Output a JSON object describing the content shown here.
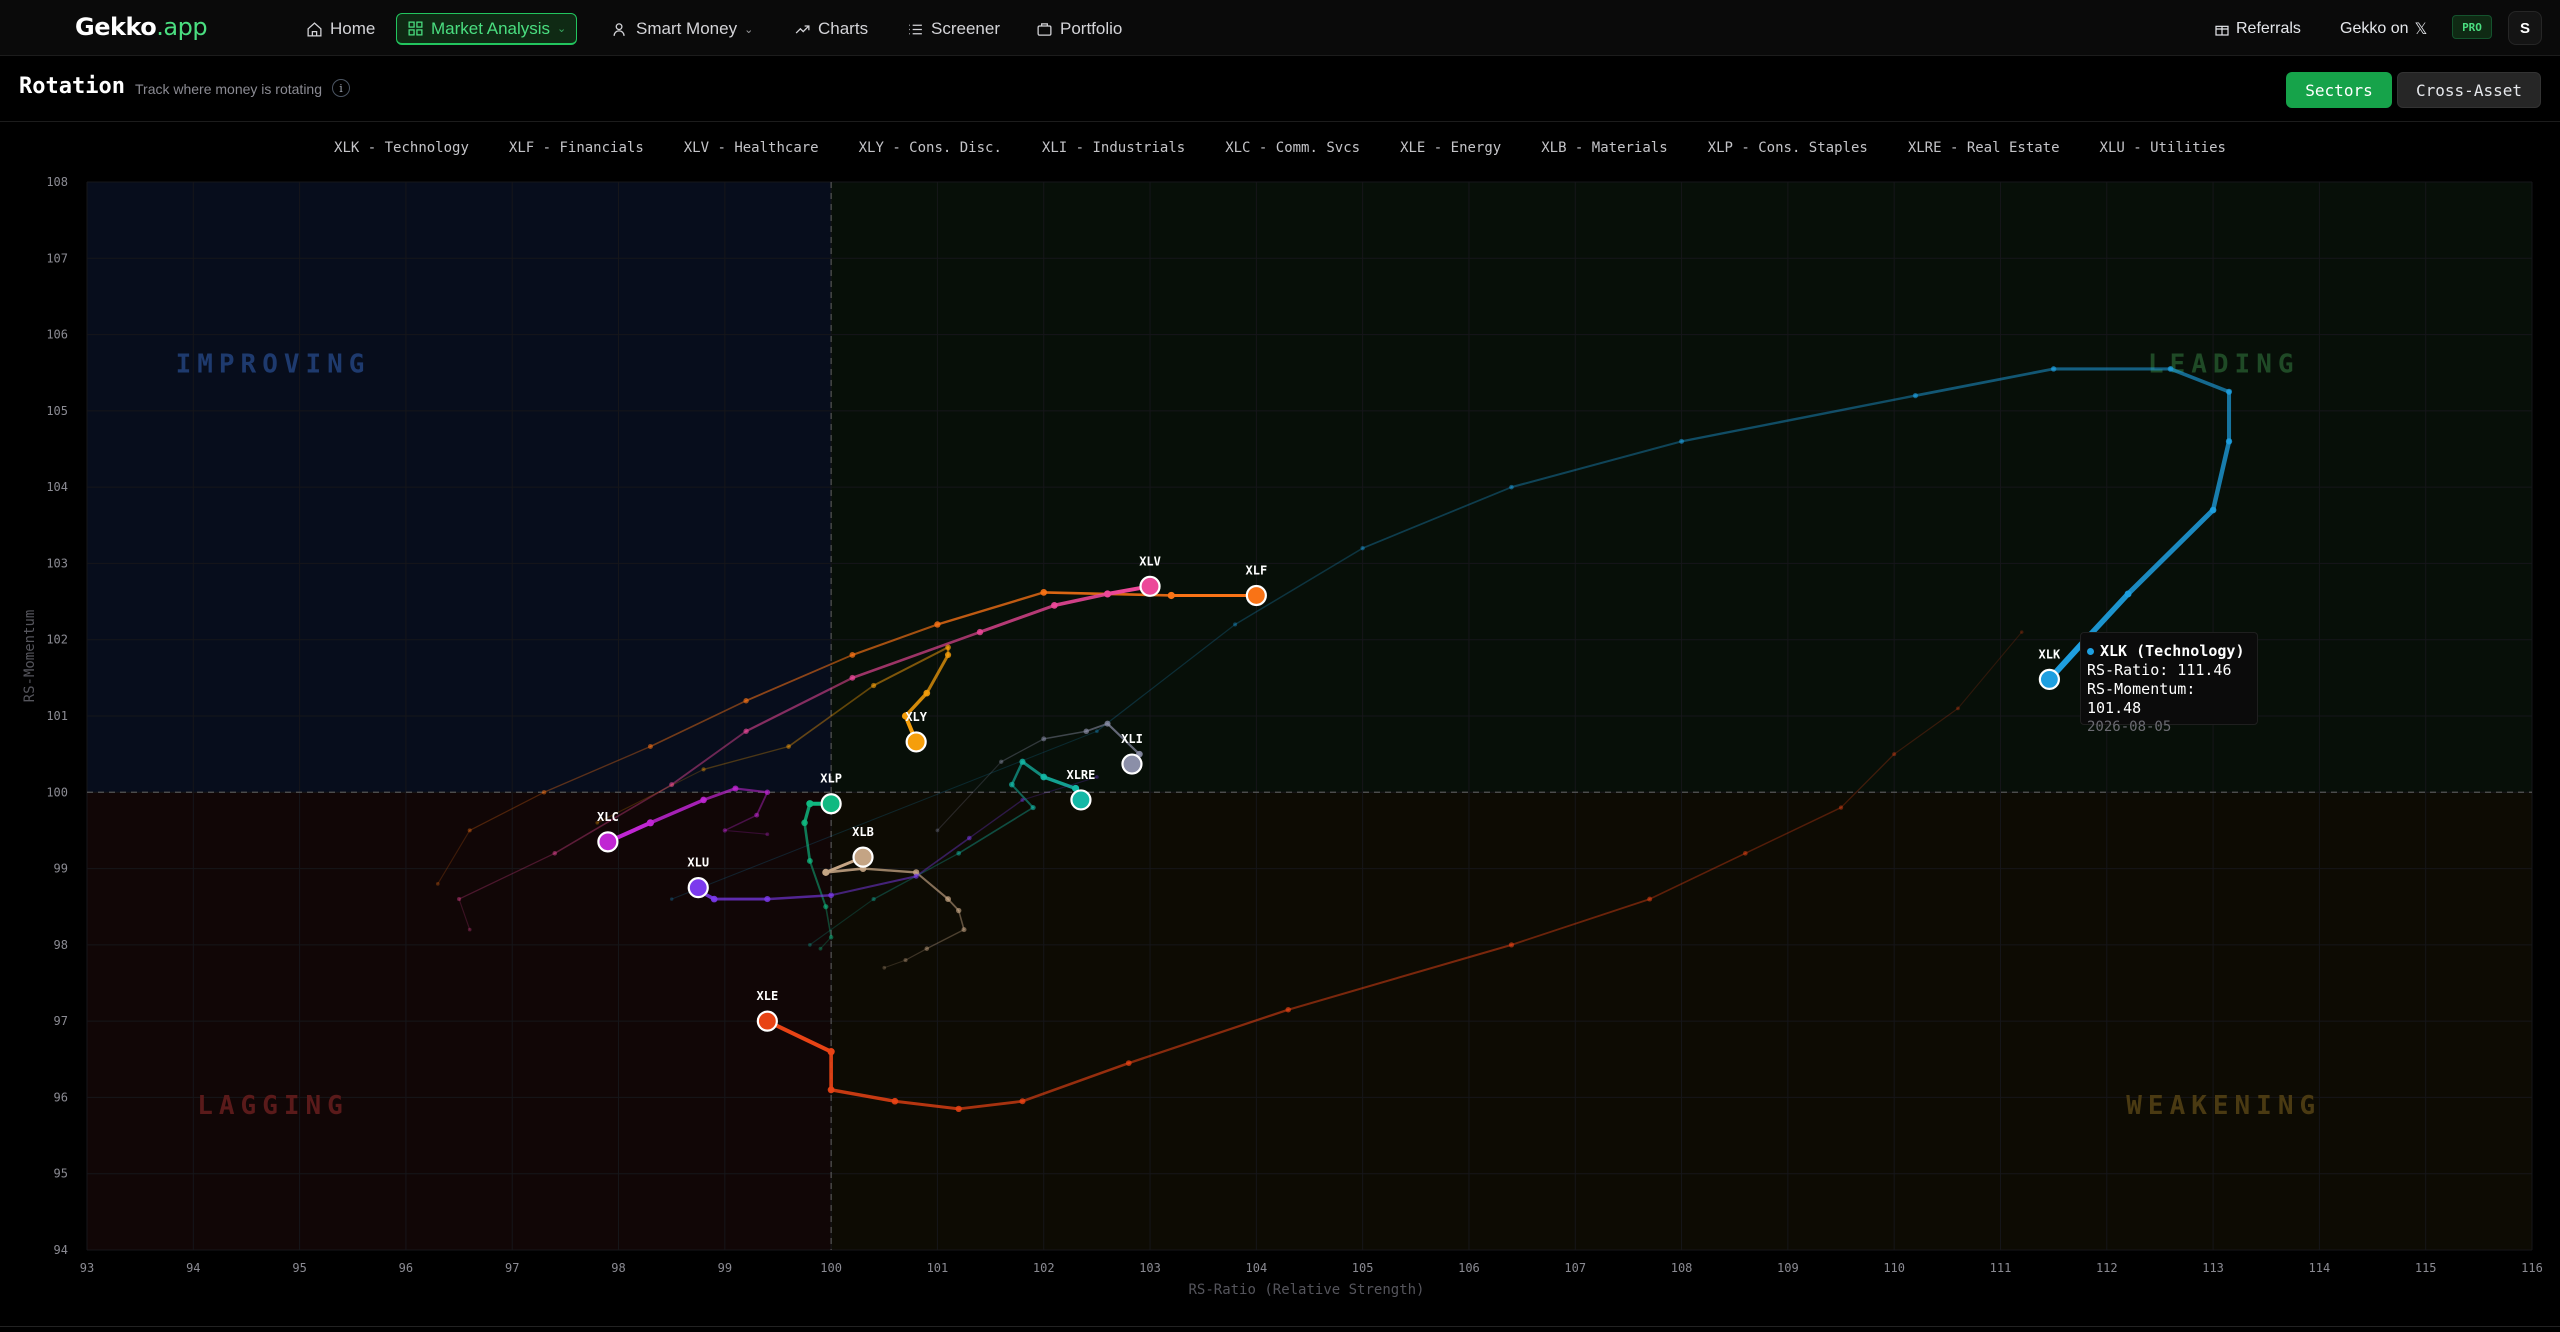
{
  "app": {
    "logo_main": "Gekko",
    "logo_suffix": ".app"
  },
  "nav": {
    "items": [
      {
        "label": "Home",
        "icon": "home-icon"
      },
      {
        "label": "Market Analysis",
        "icon": "grid-icon",
        "active": true,
        "dropdown": true
      },
      {
        "label": "Smart Money",
        "icon": "user-icon",
        "dropdown": true
      },
      {
        "label": "Charts",
        "icon": "trend-icon"
      },
      {
        "label": "Screener",
        "icon": "list-icon"
      },
      {
        "label": "Portfolio",
        "icon": "briefcase-icon"
      }
    ],
    "referrals": "Referrals",
    "gekko_on": "Gekko on",
    "x_icon": "𝕏",
    "pro": "PRO",
    "avatar": "S"
  },
  "header": {
    "title": "Rotation",
    "subtitle": "Track where money is rotating",
    "info": "i",
    "sectors_btn": "Sectors",
    "cross_asset_btn": "Cross-Asset"
  },
  "legend": [
    "XLK - Technology",
    "XLF - Financials",
    "XLV - Healthcare",
    "XLY - Cons. Disc.",
    "XLI - Industrials",
    "XLC - Comm. Svcs",
    "XLE - Energy",
    "XLB - Materials",
    "XLP - Cons. Staples",
    "XLRE - Real Estate",
    "XLU - Utilities"
  ],
  "tooltip": {
    "title": "XLK (Technology)",
    "ratio": "RS-Ratio: 111.46",
    "momentum": "RS-Momentum: 101.48",
    "date": "2026-08-05",
    "color": "#1e9fe0"
  },
  "chart_data": {
    "type": "scatter",
    "xlabel": "RS-Ratio (Relative Strength)",
    "ylabel": "RS-Momentum",
    "xlim": [
      93,
      116
    ],
    "ylim": [
      94,
      108
    ],
    "xticks": [
      93,
      94,
      95,
      96,
      97,
      98,
      99,
      100,
      101,
      102,
      103,
      104,
      105,
      106,
      107,
      108,
      109,
      110,
      111,
      112,
      113,
      114,
      115,
      116
    ],
    "yticks": [
      94,
      95,
      96,
      97,
      98,
      99,
      100,
      101,
      102,
      103,
      104,
      105,
      106,
      107,
      108
    ],
    "quadrants": {
      "improving": {
        "label": "IMPROVING",
        "color": "#1e3a6e"
      },
      "leading": {
        "label": "LEADING",
        "color": "#1f4a26"
      },
      "lagging": {
        "label": "LAGGING",
        "color": "#5a1a1a"
      },
      "weakening": {
        "label": "WEAKENING",
        "color": "#4a3a12"
      }
    },
    "series": [
      {
        "name": "XLK",
        "color": "#1e9fe0",
        "bold": 6,
        "points": [
          [
            98.5,
            98.6
          ],
          [
            102.5,
            100.8
          ],
          [
            103.8,
            102.2
          ],
          [
            105,
            103.2
          ],
          [
            106.4,
            104.0
          ],
          [
            108,
            104.6
          ],
          [
            110.2,
            105.2
          ],
          [
            111.5,
            105.55
          ],
          [
            112.6,
            105.55
          ],
          [
            113.15,
            105.25
          ],
          [
            113.15,
            104.6
          ],
          [
            113.0,
            103.7
          ],
          [
            112.2,
            102.6
          ],
          [
            111.8,
            102.0
          ],
          [
            111.46,
            101.48
          ]
        ]
      },
      {
        "name": "XLF",
        "color": "#f97316",
        "bold": 3,
        "points": [
          [
            96.3,
            98.8
          ],
          [
            96.6,
            99.5
          ],
          [
            97.3,
            100.0
          ],
          [
            98.3,
            100.6
          ],
          [
            99.2,
            101.2
          ],
          [
            100.2,
            101.8
          ],
          [
            101.0,
            102.2
          ],
          [
            102.0,
            102.62
          ],
          [
            103.2,
            102.58
          ],
          [
            104.0,
            102.58
          ]
        ]
      },
      {
        "name": "XLV",
        "color": "#ec4899",
        "bold": 4,
        "points": [
          [
            96.6,
            98.2
          ],
          [
            96.5,
            98.6
          ],
          [
            97.4,
            99.2
          ],
          [
            98.5,
            100.1
          ],
          [
            99.2,
            100.8
          ],
          [
            100.2,
            101.5
          ],
          [
            101.4,
            102.1
          ],
          [
            102.1,
            102.45
          ],
          [
            102.6,
            102.6
          ],
          [
            103.0,
            102.7
          ]
        ]
      },
      {
        "name": "XLY",
        "color": "#f59e0b",
        "bold": 4,
        "points": [
          [
            97.8,
            99.6
          ],
          [
            98.8,
            100.3
          ],
          [
            99.6,
            100.6
          ],
          [
            100.4,
            101.4
          ],
          [
            101.1,
            101.9
          ],
          [
            101.1,
            101.8
          ],
          [
            100.9,
            101.3
          ],
          [
            100.7,
            101.0
          ],
          [
            100.8,
            100.66
          ]
        ]
      },
      {
        "name": "XLI",
        "color": "#8b8fa8",
        "bold": 3,
        "points": [
          [
            101.0,
            99.5
          ],
          [
            101.6,
            100.4
          ],
          [
            102.0,
            100.7
          ],
          [
            102.4,
            100.8
          ],
          [
            102.6,
            100.9
          ],
          [
            102.9,
            100.5
          ],
          [
            102.8,
            100.3
          ],
          [
            102.83,
            100.37
          ]
        ]
      },
      {
        "name": "XLC",
        "color": "#c026d3",
        "bold": 4,
        "points": [
          [
            99.4,
            99.45
          ],
          [
            99.0,
            99.5
          ],
          [
            99.3,
            99.7
          ],
          [
            99.4,
            100.0
          ],
          [
            99.1,
            100.05
          ],
          [
            98.8,
            99.9
          ],
          [
            98.3,
            99.6
          ],
          [
            97.9,
            99.35
          ]
        ]
      },
      {
        "name": "XLE",
        "color": "#e84315",
        "bold": 4,
        "points": [
          [
            111.2,
            102.1
          ],
          [
            110.6,
            101.1
          ],
          [
            110.0,
            100.5
          ],
          [
            109.5,
            99.8
          ],
          [
            108.6,
            99.2
          ],
          [
            107.7,
            98.6
          ],
          [
            106.4,
            98.0
          ],
          [
            104.3,
            97.15
          ],
          [
            102.8,
            96.45
          ],
          [
            101.8,
            95.95
          ],
          [
            101.2,
            95.85
          ],
          [
            100.6,
            95.95
          ],
          [
            100.0,
            96.1
          ],
          [
            100.0,
            96.6
          ],
          [
            99.4,
            97.0
          ]
        ]
      },
      {
        "name": "XLB",
        "color": "#c4a484",
        "bold": 3,
        "points": [
          [
            100.5,
            97.7
          ],
          [
            100.7,
            97.8
          ],
          [
            100.9,
            97.95
          ],
          [
            101.25,
            98.2
          ],
          [
            101.2,
            98.45
          ],
          [
            101.1,
            98.6
          ],
          [
            100.8,
            98.95
          ],
          [
            100.3,
            99.0
          ],
          [
            99.95,
            98.95
          ],
          [
            100.3,
            99.15
          ]
        ]
      },
      {
        "name": "XLP",
        "color": "#10b981",
        "bold": 4,
        "points": [
          [
            99.9,
            97.95
          ],
          [
            100.0,
            98.1
          ],
          [
            99.95,
            98.5
          ],
          [
            99.8,
            99.1
          ],
          [
            99.75,
            99.6
          ],
          [
            99.8,
            99.85
          ],
          [
            100.0,
            99.85
          ]
        ]
      },
      {
        "name": "XLRE",
        "color": "#14b8a6",
        "bold": 4,
        "points": [
          [
            99.8,
            98.0
          ],
          [
            100.4,
            98.6
          ],
          [
            101.2,
            99.2
          ],
          [
            101.9,
            99.8
          ],
          [
            101.7,
            100.1
          ],
          [
            101.8,
            100.4
          ],
          [
            102.0,
            100.2
          ],
          [
            102.3,
            100.05
          ],
          [
            102.35,
            99.9
          ]
        ]
      },
      {
        "name": "XLU",
        "color": "#7c3aed",
        "bold": 4,
        "points": [
          [
            102.5,
            100.2
          ],
          [
            101.8,
            99.9
          ],
          [
            101.3,
            99.4
          ],
          [
            100.8,
            98.9
          ],
          [
            100.0,
            98.65
          ],
          [
            99.4,
            98.6
          ],
          [
            98.9,
            98.6
          ],
          [
            98.7,
            98.75
          ],
          [
            98.75,
            98.75
          ]
        ]
      }
    ]
  }
}
